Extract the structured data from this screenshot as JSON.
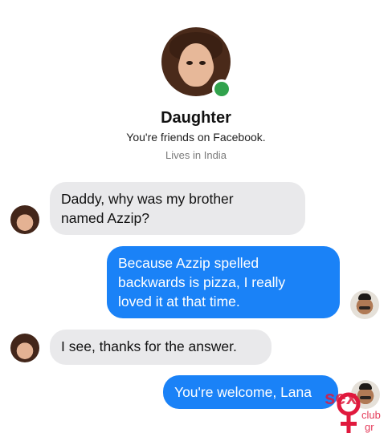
{
  "profile": {
    "name": "Daughter",
    "friends_text": "You're friends on Facebook.",
    "location_text": "Lives in India",
    "status": "online",
    "status_color": "#31a24c"
  },
  "messages": [
    {
      "sender": "daughter",
      "direction": "incoming",
      "text": "Daddy, why was my brother\nnamed Azzip?"
    },
    {
      "sender": "dad",
      "direction": "outgoing",
      "text": "Because Azzip spelled\nbackwards is pizza, I really\nloved it at that time."
    },
    {
      "sender": "daughter",
      "direction": "incoming",
      "text": "I see, thanks for the answer."
    },
    {
      "sender": "dad",
      "direction": "outgoing",
      "text": "You're welcome, Lana"
    }
  ],
  "colors": {
    "incoming_bubble": "#e9e9eb",
    "outgoing_bubble": "#1a82f7"
  },
  "watermark": {
    "text_top": "sex",
    "text_mid": "club",
    "text_bottom": "gr",
    "color": "#e0193d"
  }
}
